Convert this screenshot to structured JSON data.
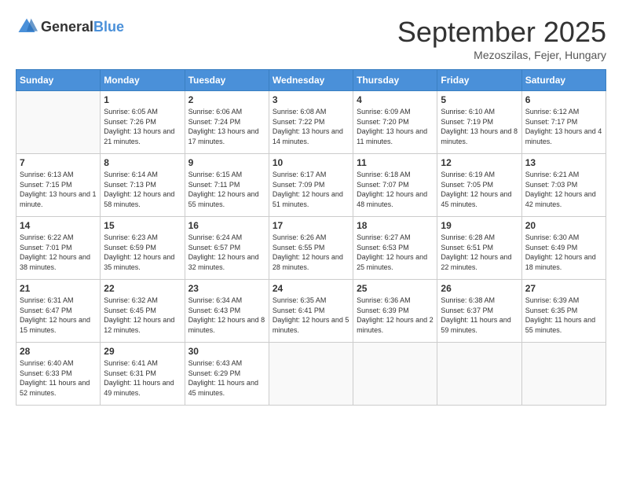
{
  "header": {
    "logo_general": "General",
    "logo_blue": "Blue",
    "month": "September 2025",
    "location": "Mezoszilas, Fejer, Hungary"
  },
  "days_of_week": [
    "Sunday",
    "Monday",
    "Tuesday",
    "Wednesday",
    "Thursday",
    "Friday",
    "Saturday"
  ],
  "weeks": [
    [
      {
        "day": "",
        "sunrise": "",
        "sunset": "",
        "daylight": ""
      },
      {
        "day": "1",
        "sunrise": "Sunrise: 6:05 AM",
        "sunset": "Sunset: 7:26 PM",
        "daylight": "Daylight: 13 hours and 21 minutes."
      },
      {
        "day": "2",
        "sunrise": "Sunrise: 6:06 AM",
        "sunset": "Sunset: 7:24 PM",
        "daylight": "Daylight: 13 hours and 17 minutes."
      },
      {
        "day": "3",
        "sunrise": "Sunrise: 6:08 AM",
        "sunset": "Sunset: 7:22 PM",
        "daylight": "Daylight: 13 hours and 14 minutes."
      },
      {
        "day": "4",
        "sunrise": "Sunrise: 6:09 AM",
        "sunset": "Sunset: 7:20 PM",
        "daylight": "Daylight: 13 hours and 11 minutes."
      },
      {
        "day": "5",
        "sunrise": "Sunrise: 6:10 AM",
        "sunset": "Sunset: 7:19 PM",
        "daylight": "Daylight: 13 hours and 8 minutes."
      },
      {
        "day": "6",
        "sunrise": "Sunrise: 6:12 AM",
        "sunset": "Sunset: 7:17 PM",
        "daylight": "Daylight: 13 hours and 4 minutes."
      }
    ],
    [
      {
        "day": "7",
        "sunrise": "Sunrise: 6:13 AM",
        "sunset": "Sunset: 7:15 PM",
        "daylight": "Daylight: 13 hours and 1 minute."
      },
      {
        "day": "8",
        "sunrise": "Sunrise: 6:14 AM",
        "sunset": "Sunset: 7:13 PM",
        "daylight": "Daylight: 12 hours and 58 minutes."
      },
      {
        "day": "9",
        "sunrise": "Sunrise: 6:15 AM",
        "sunset": "Sunset: 7:11 PM",
        "daylight": "Daylight: 12 hours and 55 minutes."
      },
      {
        "day": "10",
        "sunrise": "Sunrise: 6:17 AM",
        "sunset": "Sunset: 7:09 PM",
        "daylight": "Daylight: 12 hours and 51 minutes."
      },
      {
        "day": "11",
        "sunrise": "Sunrise: 6:18 AM",
        "sunset": "Sunset: 7:07 PM",
        "daylight": "Daylight: 12 hours and 48 minutes."
      },
      {
        "day": "12",
        "sunrise": "Sunrise: 6:19 AM",
        "sunset": "Sunset: 7:05 PM",
        "daylight": "Daylight: 12 hours and 45 minutes."
      },
      {
        "day": "13",
        "sunrise": "Sunrise: 6:21 AM",
        "sunset": "Sunset: 7:03 PM",
        "daylight": "Daylight: 12 hours and 42 minutes."
      }
    ],
    [
      {
        "day": "14",
        "sunrise": "Sunrise: 6:22 AM",
        "sunset": "Sunset: 7:01 PM",
        "daylight": "Daylight: 12 hours and 38 minutes."
      },
      {
        "day": "15",
        "sunrise": "Sunrise: 6:23 AM",
        "sunset": "Sunset: 6:59 PM",
        "daylight": "Daylight: 12 hours and 35 minutes."
      },
      {
        "day": "16",
        "sunrise": "Sunrise: 6:24 AM",
        "sunset": "Sunset: 6:57 PM",
        "daylight": "Daylight: 12 hours and 32 minutes."
      },
      {
        "day": "17",
        "sunrise": "Sunrise: 6:26 AM",
        "sunset": "Sunset: 6:55 PM",
        "daylight": "Daylight: 12 hours and 28 minutes."
      },
      {
        "day": "18",
        "sunrise": "Sunrise: 6:27 AM",
        "sunset": "Sunset: 6:53 PM",
        "daylight": "Daylight: 12 hours and 25 minutes."
      },
      {
        "day": "19",
        "sunrise": "Sunrise: 6:28 AM",
        "sunset": "Sunset: 6:51 PM",
        "daylight": "Daylight: 12 hours and 22 minutes."
      },
      {
        "day": "20",
        "sunrise": "Sunrise: 6:30 AM",
        "sunset": "Sunset: 6:49 PM",
        "daylight": "Daylight: 12 hours and 18 minutes."
      }
    ],
    [
      {
        "day": "21",
        "sunrise": "Sunrise: 6:31 AM",
        "sunset": "Sunset: 6:47 PM",
        "daylight": "Daylight: 12 hours and 15 minutes."
      },
      {
        "day": "22",
        "sunrise": "Sunrise: 6:32 AM",
        "sunset": "Sunset: 6:45 PM",
        "daylight": "Daylight: 12 hours and 12 minutes."
      },
      {
        "day": "23",
        "sunrise": "Sunrise: 6:34 AM",
        "sunset": "Sunset: 6:43 PM",
        "daylight": "Daylight: 12 hours and 8 minutes."
      },
      {
        "day": "24",
        "sunrise": "Sunrise: 6:35 AM",
        "sunset": "Sunset: 6:41 PM",
        "daylight": "Daylight: 12 hours and 5 minutes."
      },
      {
        "day": "25",
        "sunrise": "Sunrise: 6:36 AM",
        "sunset": "Sunset: 6:39 PM",
        "daylight": "Daylight: 12 hours and 2 minutes."
      },
      {
        "day": "26",
        "sunrise": "Sunrise: 6:38 AM",
        "sunset": "Sunset: 6:37 PM",
        "daylight": "Daylight: 11 hours and 59 minutes."
      },
      {
        "day": "27",
        "sunrise": "Sunrise: 6:39 AM",
        "sunset": "Sunset: 6:35 PM",
        "daylight": "Daylight: 11 hours and 55 minutes."
      }
    ],
    [
      {
        "day": "28",
        "sunrise": "Sunrise: 6:40 AM",
        "sunset": "Sunset: 6:33 PM",
        "daylight": "Daylight: 11 hours and 52 minutes."
      },
      {
        "day": "29",
        "sunrise": "Sunrise: 6:41 AM",
        "sunset": "Sunset: 6:31 PM",
        "daylight": "Daylight: 11 hours and 49 minutes."
      },
      {
        "day": "30",
        "sunrise": "Sunrise: 6:43 AM",
        "sunset": "Sunset: 6:29 PM",
        "daylight": "Daylight: 11 hours and 45 minutes."
      },
      {
        "day": "",
        "sunrise": "",
        "sunset": "",
        "daylight": ""
      },
      {
        "day": "",
        "sunrise": "",
        "sunset": "",
        "daylight": ""
      },
      {
        "day": "",
        "sunrise": "",
        "sunset": "",
        "daylight": ""
      },
      {
        "day": "",
        "sunrise": "",
        "sunset": "",
        "daylight": ""
      }
    ]
  ]
}
